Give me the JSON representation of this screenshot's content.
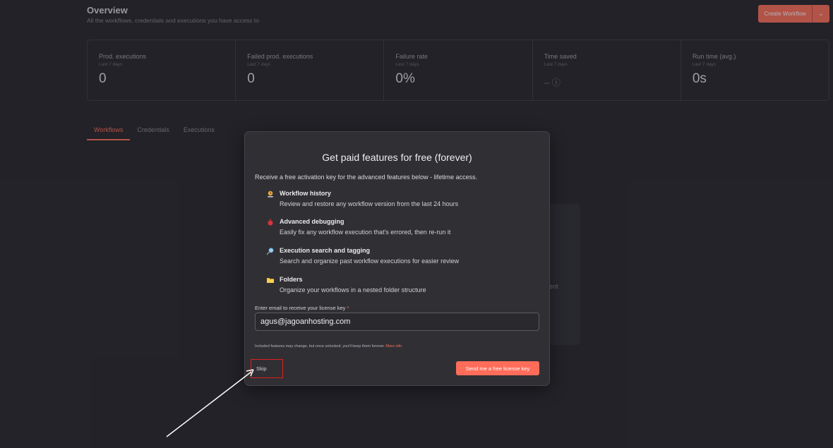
{
  "header": {
    "title": "Overview",
    "subtitle": "All the workflows, credentials and executions you have access to",
    "create_button_label": "Create Workflow",
    "create_chevron": "⌄"
  },
  "stats": [
    {
      "label": "Prod. executions",
      "period": "Last 7 days",
      "value": "0"
    },
    {
      "label": "Failed prod. executions",
      "period": "Last 7 days",
      "value": "0"
    },
    {
      "label": "Failure rate",
      "period": "Last 7 days",
      "value": "0%"
    },
    {
      "label": "Time saved",
      "period": "Last 7 days",
      "value": "-- ⓘ"
    },
    {
      "label": "Run time (avg.)",
      "period": "Last 7 days",
      "value": "0s"
    }
  ],
  "tabs": [
    {
      "label": "Workflows",
      "active": true
    },
    {
      "label": "Credentials",
      "active": false
    },
    {
      "label": "Executions",
      "active": false
    }
  ],
  "background_card_text": "ent",
  "modal": {
    "title": "Get paid features for free (forever)",
    "intro": "Receive a free activation key for the advanced features below - lifetime access.",
    "features": [
      {
        "icon": "history-icon",
        "title": "Workflow history",
        "description": "Review and restore any workflow version from the last 24 hours"
      },
      {
        "icon": "bug-icon",
        "title": "Advanced debugging",
        "description": "Easily fix any workflow execution that's errored, then re-run it"
      },
      {
        "icon": "magnifier-icon",
        "title": "Execution search and tagging",
        "description": "Search and organize past workflow executions for easier review"
      },
      {
        "icon": "folder-icon",
        "title": "Folders",
        "description": "Organize your workflows in a nested folder structure"
      }
    ],
    "email_label": "Enter email to receive your license key",
    "required_marker": "*",
    "email_value": "agus@jagoanhosting.com",
    "disclaimer": "Included features may change, but once unlocked, you'll keep them forever.",
    "more_info_label": "More info",
    "skip_label": "Skip",
    "send_label": "Send me a free license key"
  },
  "colors": {
    "accent": "#ff6d5a",
    "highlight_box": "#e01e1e",
    "modal_bg": "#303034",
    "page_bg": "#232329"
  }
}
